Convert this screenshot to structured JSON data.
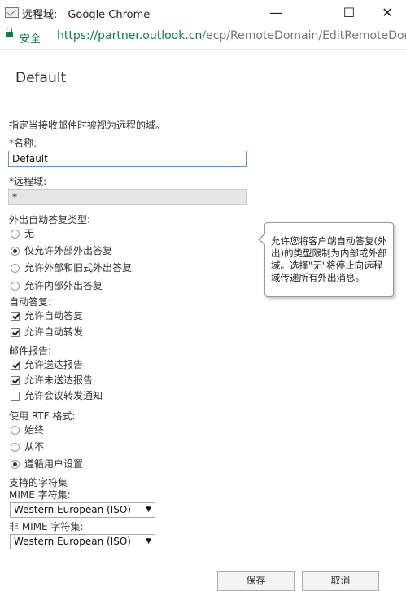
{
  "window": {
    "title": "远程域: - Google Chrome",
    "minimize": "—",
    "maximize": "☐",
    "close": "✕"
  },
  "address": {
    "secure_label": "安全",
    "url_host": "https://partner.outlook.cn",
    "url_path": "/ecp/RemoteDomain/EditRemoteDon"
  },
  "page": {
    "title": "Default",
    "description": "指定当接收邮件时被视为远程的域。",
    "name_label": "*名称:",
    "name_value": "Default",
    "remote_domain_label": "*远程域:",
    "remote_domain_value": "*",
    "ooo_label": "外出自动答复类型:",
    "ooo_options": [
      "无",
      "仅允许外部外出答复",
      "允许外部和旧式外出答复",
      "允许内部外出答复"
    ],
    "ooo_selected": 1,
    "auto_label": "自动答复:",
    "auto_options": [
      "允许自动答复",
      "允许自动转发"
    ],
    "report_label": "邮件报告:",
    "report_options": [
      "允许送达报告",
      "允许未送达报告",
      "允许会议转发通知"
    ],
    "rtf_label": "使用 RTF 格式:",
    "rtf_options": [
      "始终",
      "从不",
      "遵循用户设置"
    ],
    "rtf_selected": 2,
    "charset_label": "支持的字符集",
    "mime_label": "MIME 字符集:",
    "mime_value": "Western European (ISO)",
    "nonmime_label": "非 MIME 字符集:",
    "nonmime_value": "Western European (ISO)",
    "callout": "允许您将客户端自动答复(外出)的类型限制为内部或外部域。选择\"无\"将停止向远程域传递所有外出消息。",
    "save_button": "保存",
    "cancel_button": "取消"
  }
}
